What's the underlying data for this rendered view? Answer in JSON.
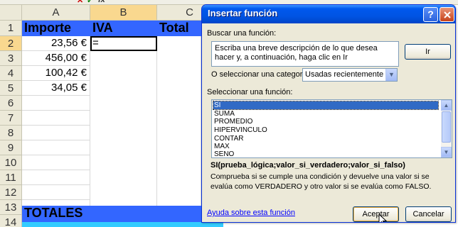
{
  "sheet": {
    "formula_bar": {
      "icons": [
        "cancel-icon",
        "enter-icon",
        "fx-icon"
      ],
      "colors": {
        "cancel": "#cc0000",
        "enter": "#008000"
      }
    },
    "columns": [
      "A",
      "B",
      "C"
    ],
    "rows": [
      "1",
      "2",
      "3",
      "4",
      "5",
      "6",
      "7",
      "8",
      "9",
      "10",
      "11",
      "12",
      "13",
      "14"
    ],
    "header": {
      "a": "Importe",
      "b": "IVA",
      "c": "Total"
    },
    "amounts": [
      "23,56 €",
      "456,00 €",
      "100,42 €",
      "34,05 €"
    ],
    "active_cell_value": "=",
    "totals_label": "TOTALES",
    "colors": {
      "header_fill": "#3366ff",
      "bottom_fill": "#33ccff",
      "selected_header": "#f9d88f"
    }
  },
  "dialog": {
    "title": "Insertar función",
    "help_button": "?",
    "close_button": "X",
    "search_label": "Buscar una función:",
    "search_text": "Escriba una breve descripción de lo que desea hacer y, a continuación, haga clic en Ir",
    "go_button": "Ir",
    "category_label": "O seleccionar una categoría:",
    "category_value": "Usadas recientemente",
    "function_label": "Seleccionar una función:",
    "functions": [
      "SI",
      "SUMA",
      "PROMEDIO",
      "HIPERVINCULO",
      "CONTAR",
      "MAX",
      "SENO"
    ],
    "selected_function": "SI",
    "syntax": "SI(prueba_lógica;valor_si_verdadero;valor_si_falso)",
    "description": "Comprueba si se cumple una condición y devuelve una valor si se evalúa como VERDADERO y otro valor si se evalúa como FALSO.",
    "help_link": "Ayuda sobre esta función",
    "ok_button": "Aceptar",
    "cancel_button": "Cancelar",
    "colors": {
      "titlebar": "#0054e3",
      "selection": "#316ac5",
      "link": "#0000ff",
      "body": "#ece9d8"
    }
  }
}
